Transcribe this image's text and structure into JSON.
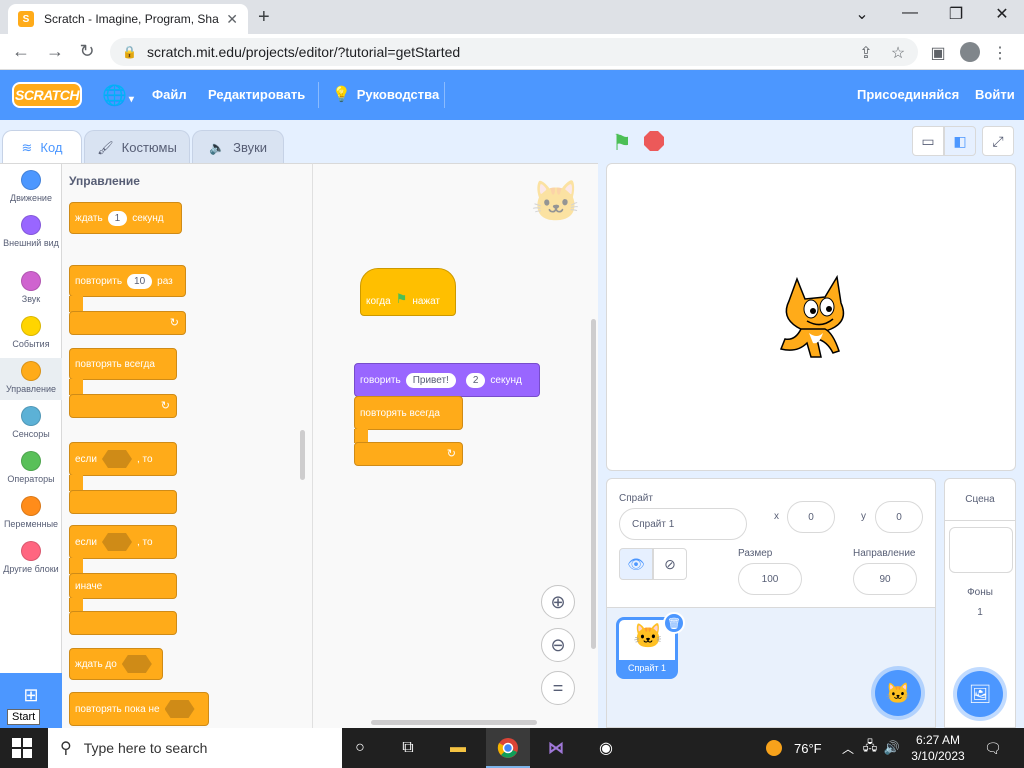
{
  "browser": {
    "tab_title": "Scratch - Imagine, Program, Sha",
    "favicon_letter": "S",
    "url": "scratch.mit.edu/projects/editor/?tutorial=getStarted"
  },
  "menubar": {
    "logo": "SCRATCH",
    "file": "Файл",
    "edit": "Редактировать",
    "tutorials": "Руководства",
    "join": "Присоединяйся",
    "signin": "Войти"
  },
  "editor_tabs": {
    "code": "Код",
    "costumes": "Костюмы",
    "sounds": "Звуки"
  },
  "categories": [
    {
      "label": "Движение",
      "color": "#4c97ff"
    },
    {
      "label": "Внешний вид",
      "color": "#9966ff"
    },
    {
      "label": "Звук",
      "color": "#cf63cf"
    },
    {
      "label": "События",
      "color": "#ffd500"
    },
    {
      "label": "Управление",
      "color": "#ffab19"
    },
    {
      "label": "Сенсоры",
      "color": "#5cb1d6"
    },
    {
      "label": "Операторы",
      "color": "#59c059"
    },
    {
      "label": "Переменные",
      "color": "#ff8c1a"
    },
    {
      "label": "Другие блоки",
      "color": "#ff6680"
    }
  ],
  "start_label": "Start",
  "palette": {
    "title": "Управление",
    "wait": {
      "prefix": "ждать",
      "value": "1",
      "suffix": "секунд"
    },
    "repeat": {
      "prefix": "повторить",
      "value": "10",
      "suffix": "раз"
    },
    "forever": "повторять всегда",
    "if_then": {
      "prefix": "если",
      "suffix": ", то"
    },
    "if_else": {
      "prefix": "если",
      "suffix": ", то",
      "else": "иначе"
    },
    "wait_until": "ждать до",
    "repeat_until": "повторять пока не"
  },
  "script": {
    "hat": {
      "prefix": "когда",
      "suffix": "нажат"
    },
    "say": {
      "prefix": "говорить",
      "message": "Привет!",
      "secs": "2",
      "suffix": "секунд"
    },
    "forever": "повторять всегда"
  },
  "sprite_info": {
    "sprite_label": "Спрайт",
    "sprite_name": "Спрайт 1",
    "x_label": "x",
    "x_value": "0",
    "y_label": "y",
    "y_value": "0",
    "show_label": "Показать",
    "size_label": "Размер",
    "size_value": "100",
    "direction_label": "Направление",
    "direction_value": "90",
    "tile_name": "Спрайт 1"
  },
  "stage_panel": {
    "title": "Сцена",
    "backdrops_label": "Фоны",
    "backdrops_count": "1"
  },
  "taskbar": {
    "search_placeholder": "Type here to search",
    "weather": "76°F",
    "time": "6:27 AM",
    "date": "3/10/2023"
  }
}
